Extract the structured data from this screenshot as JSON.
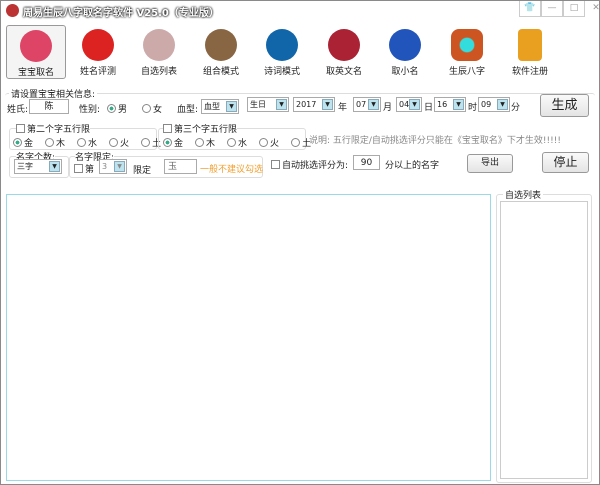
{
  "window": {
    "title": "周易生辰八字取名字软件 V25.0（专业版）"
  },
  "toolbar": [
    {
      "label": "宝宝取名",
      "icon": "baby-icon",
      "color": "#d46"
    },
    {
      "label": "姓名评测",
      "icon": "name-test-icon",
      "color": "#d22"
    },
    {
      "label": "自选列表",
      "icon": "brush-icon",
      "color": "#caa"
    },
    {
      "label": "组合模式",
      "icon": "lion-icon",
      "color": "#864"
    },
    {
      "label": "诗词模式",
      "icon": "book-icon",
      "color": "#16a"
    },
    {
      "label": "取英文名",
      "icon": "barca-icon",
      "color": "#a23"
    },
    {
      "label": "取小名",
      "icon": "dragon-icon",
      "color": "#25b"
    },
    {
      "label": "生辰八字",
      "icon": "bagua-icon",
      "color": "#c52"
    },
    {
      "label": "软件注册",
      "icon": "lock-icon",
      "color": "#e9a020"
    }
  ],
  "info": {
    "group_label": "请设置宝宝相关信息:",
    "surname_label": "姓氏:",
    "surname": "陈",
    "gender_label": "性别:",
    "male": "男",
    "female": "女",
    "blood_label": "血型:",
    "blood": "血型",
    "birth": "生日",
    "year": "2017",
    "year_unit": "年",
    "month": "07",
    "month_unit": "月",
    "day": "04",
    "day_unit": "日",
    "hour": "16",
    "hour_unit": "时",
    "minute": "09",
    "minute_unit": "分",
    "generate": "生成",
    "second_char": "第二个字五行限",
    "third_char": "第三个字五行限",
    "elements": [
      "金",
      "木",
      "水",
      "火",
      "土"
    ],
    "note": "说明: 五行限定/自动挑选评分只能在《宝宝取名》下才生效!!!!!",
    "count_label": "名字个数:",
    "count": "三字",
    "limit_label": "名字限定:",
    "limit_pos_prefix": "第",
    "limit_pos": "3",
    "limit_suffix": "限定",
    "limit_char": "玉",
    "limit_warn": "一般不建议勾选",
    "auto_label": "自动挑选评分为:",
    "auto_score": "90",
    "auto_suffix": "分以上的名字",
    "export": "导出",
    "stop": "停止"
  },
  "right": {
    "label": "自选列表"
  }
}
